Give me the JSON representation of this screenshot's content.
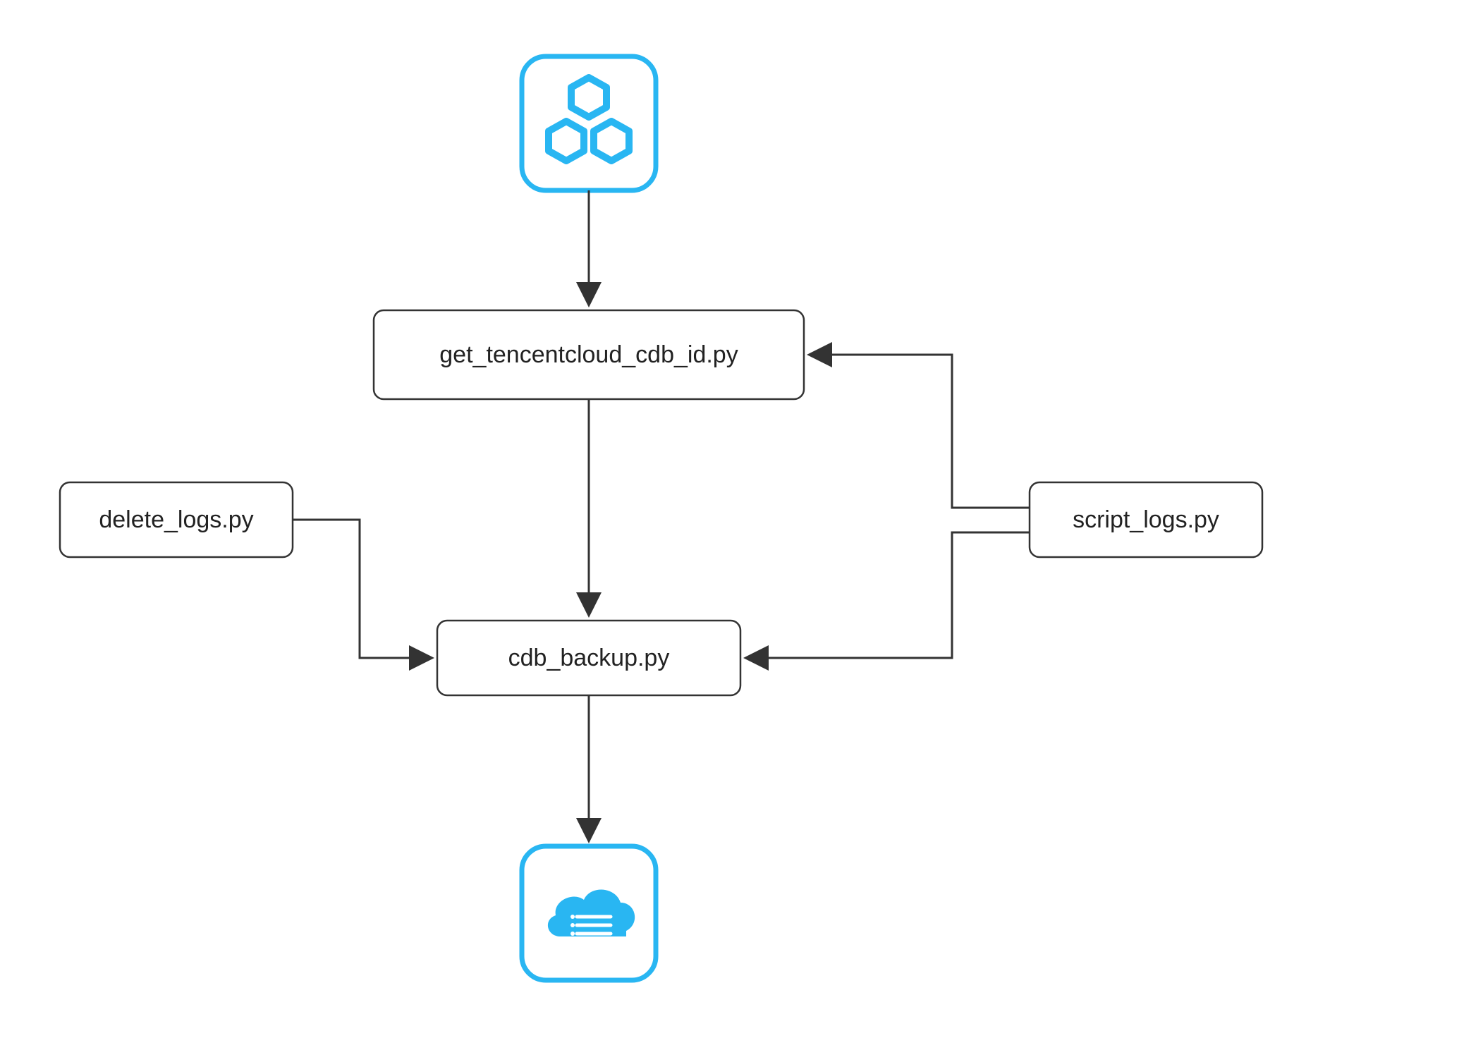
{
  "diagram": {
    "nodes": {
      "top_icon": "cluster-hex-icon",
      "get_id": "get_tencentcloud_cdb_id.py",
      "delete_logs": "delete_logs.py",
      "script_logs": "script_logs.py",
      "cdb_backup": "cdb_backup.py",
      "bottom_icon": "cloud-db-icon"
    },
    "edges": [
      {
        "from": "top_icon",
        "to": "get_id"
      },
      {
        "from": "get_id",
        "to": "cdb_backup"
      },
      {
        "from": "delete_logs",
        "to": "cdb_backup"
      },
      {
        "from": "script_logs",
        "to": "get_id"
      },
      {
        "from": "script_logs",
        "to": "cdb_backup"
      },
      {
        "from": "cdb_backup",
        "to": "bottom_icon"
      }
    ],
    "colors": {
      "accent": "#29b6f2",
      "stroke": "#333333",
      "background": "#ffffff"
    }
  }
}
